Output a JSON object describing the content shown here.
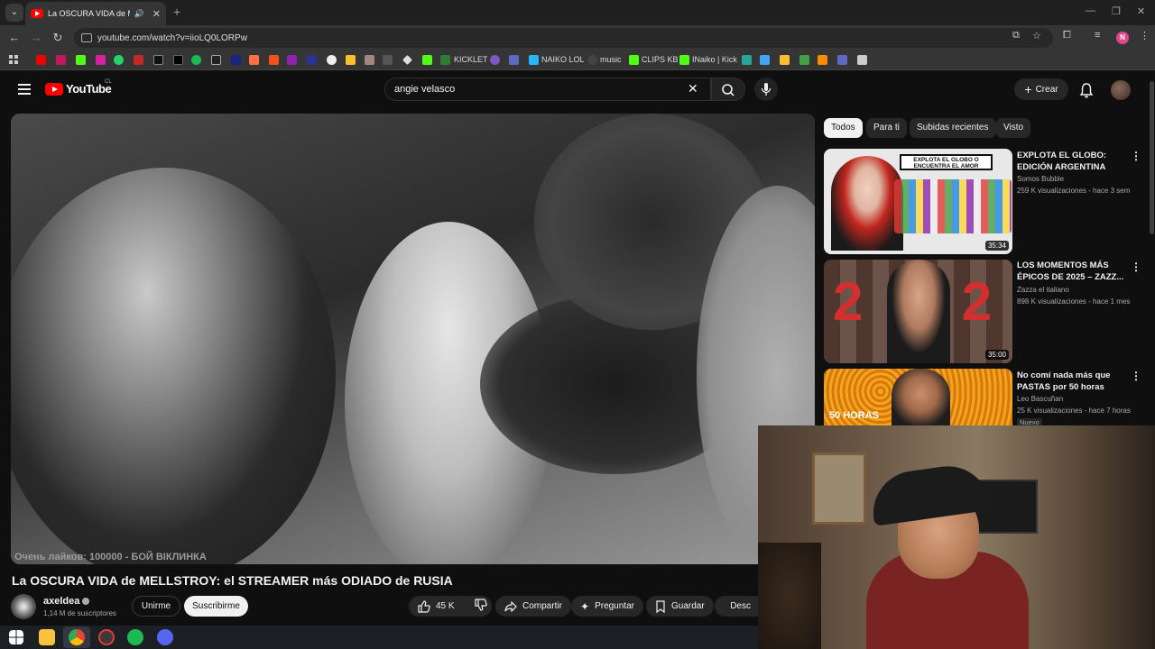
{
  "browser": {
    "tab_title": "La OSCURA VIDA de MELLSTROY",
    "url": "youtube.com/watch?v=iioLQ0LORPw",
    "profile_initial": "N",
    "bookmarks": {
      "kicklet": "KICKLET",
      "naiko_lol": "NAIKO LOL",
      "music": "music",
      "clips_kb": "CLIPS KB",
      "naiko_kick": "INaiko | Kick"
    }
  },
  "youtube": {
    "logo_text": "YouTube",
    "country_code": "CL",
    "search_query": "angie velasco",
    "create_label": "Crear"
  },
  "video": {
    "title": "La OSCURA VIDA de MELLSTROY: el STREAMER más ODIADO de RUSIA",
    "watermark": "Очень лайков: 100000 - БОЙ ВІКЛИНКА",
    "channel": "axeldea",
    "subscribers": "1,14 M de suscriptores",
    "join_label": "Unirme",
    "subscribe_label": "Suscribirme",
    "likes": "45 K",
    "share_label": "Compartir",
    "ask_label": "Preguntar",
    "save_label": "Guardar",
    "download_label": "Desc"
  },
  "filters": [
    "Todos",
    "Para ti",
    "Subidas recientes",
    "Visto"
  ],
  "recommendations": [
    {
      "title": "EXPLOTA EL GLOBO: EDICIÓN ARGENTINA",
      "channel": "Somos Bubble",
      "meta": "259 K visualizaciones - hace 3 sem",
      "duration": "35:34",
      "thumb_text": "EXPLOTA EL GLOBO O ENCUENTRA EL AMOR"
    },
    {
      "title": "LOS MOMENTOS MÁS ÉPICOS DE 2025 – ZAZZ...",
      "channel": "Zazza el italiano",
      "meta": "898 K visualizaciones - hace 1 mes",
      "duration": "35:00",
      "thumb_text": "2025"
    },
    {
      "title": "No comí nada más que PASTAS por 50 horas",
      "channel": "Leo Bascuñan",
      "meta": "25 K visualizaciones - hace 7 horas",
      "badge": "Nuevo",
      "thumb_text": "50 HORAS"
    }
  ]
}
